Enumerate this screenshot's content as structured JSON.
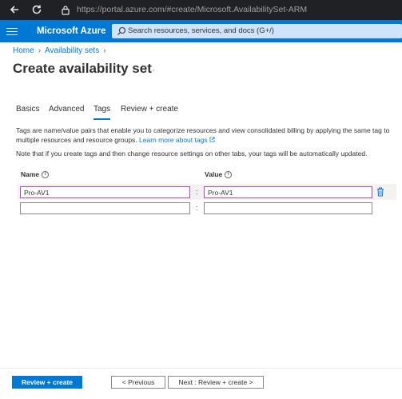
{
  "browser": {
    "url": "https://portal.azure.com/#create/Microsoft.AvailabilitySet-ARM"
  },
  "header": {
    "brand": "Microsoft Azure",
    "search_placeholder": "Search resources, services, and docs (G+/)",
    "accent_color": "#0078d4"
  },
  "breadcrumb": {
    "home": "Home",
    "availability_sets": "Availability sets"
  },
  "page": {
    "title": "Create availability set",
    "more": "···"
  },
  "tabs": [
    {
      "label": "Basics",
      "active": false
    },
    {
      "label": "Advanced",
      "active": false
    },
    {
      "label": "Tags",
      "active": true
    },
    {
      "label": "Review + create",
      "active": false
    }
  ],
  "description": {
    "text": "Tags are name/value pairs that enable you to categorize resources and view consolidated billing by applying the same tag to multiple resources and resource groups.",
    "link": "Learn more about tags",
    "note": "Note that if you create tags and then change resource settings on other tabs, your tags will be automatically updated."
  },
  "tags_table": {
    "name_header": "Name",
    "value_header": "Value",
    "separator": ":",
    "rows": [
      {
        "name": "Pro-AV1",
        "value": "Pro-AV1"
      },
      {
        "name": "",
        "value": ""
      }
    ]
  },
  "footer": {
    "review_create": "Review + create",
    "previous": "< Previous",
    "next": "Next : Review + create >"
  }
}
